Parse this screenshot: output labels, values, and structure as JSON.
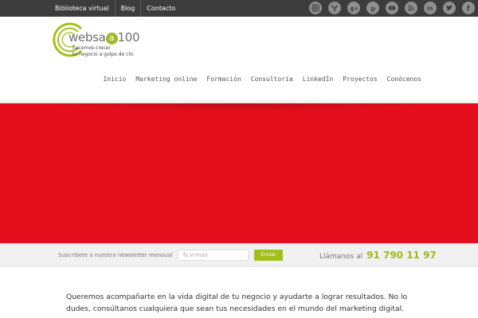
{
  "topbar": {
    "links": [
      "Biblioteca virtual",
      "Blog",
      "Contacto"
    ],
    "social_icons": [
      "instagram-icon",
      "scoop-icon",
      "google-plus-icon",
      "pinterest-icon",
      "youtube-icon",
      "rss-icon",
      "linkedin-icon",
      "twitter-icon",
      "facebook-icon"
    ]
  },
  "logo": {
    "name_prefix": "websa",
    "name_letter": "a",
    "name_suffix": "100",
    "tagline_1": "hacemos crecer",
    "tagline_2": "tu negocio a golpe de clic"
  },
  "nav": {
    "items": [
      "Inicio",
      "Marketing online",
      "Formación",
      "Consultoría",
      "LinkedIn",
      "Proyectos",
      "Conócenos"
    ]
  },
  "hero": {
    "color": "#e30d1b"
  },
  "newsletter": {
    "label": "Suscríbete a nuestra newsletter mensual",
    "placeholder": "Tu e-mail",
    "button": "Enviar"
  },
  "call": {
    "label": "Llámanos al",
    "phone": "91 790 11 97"
  },
  "intro": {
    "text": "Queremos acompañarte en la vida digital de tu negocio y ayudarte a lograr resultados. No lo dudes, consúltanos cualquiera que sean tus necesidades en el mundo del marketing digital."
  },
  "colors": {
    "accent": "#a3c01a",
    "topbar": "#3c3c3c"
  }
}
